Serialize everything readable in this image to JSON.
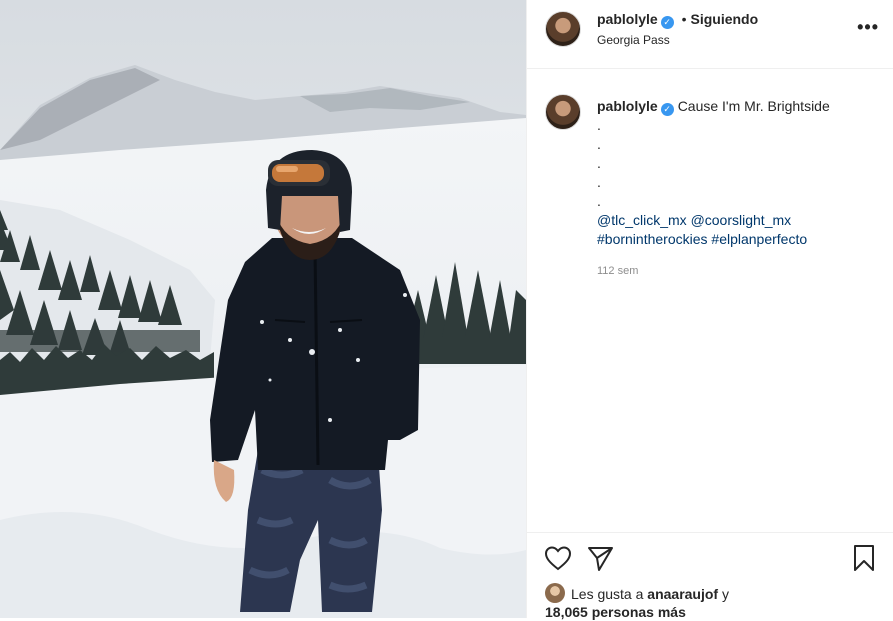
{
  "post": {
    "username": "pablolyle",
    "verified_icon": "verified-badge-icon",
    "separator": "•",
    "follow_status": "Siguiendo",
    "location": "Georgia Pass",
    "more_icon": "more-options-icon"
  },
  "caption": {
    "username": "pablolyle",
    "text": "Cause I'm Mr. Brightside",
    "dots": [
      ".",
      ".",
      ".",
      ".",
      "."
    ],
    "mentions": [
      "@tlc_click_mx",
      "@coorslight_mx"
    ],
    "hashtags": [
      "#bornintherockies",
      "#elplanperfecto"
    ],
    "age": "112 sem"
  },
  "actions": {
    "like_icon": "heart-icon",
    "share_icon": "share-icon",
    "save_icon": "bookmark-icon"
  },
  "likes": {
    "prefix": "Les gusta a",
    "user": "anaaraujof",
    "connector": "y",
    "count_text": "18,065 personas más"
  },
  "colors": {
    "link": "#00376b",
    "verified": "#3897f0",
    "muted": "#8e8e8e"
  }
}
